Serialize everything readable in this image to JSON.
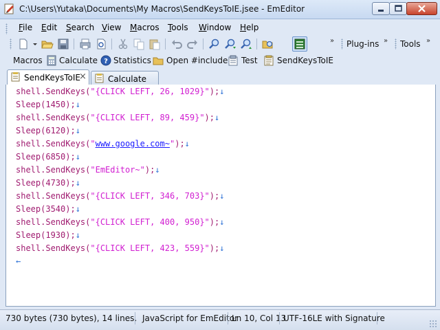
{
  "window": {
    "title": "C:\\Users\\Yutaka\\Documents\\My Macros\\SendKeysToIE.jsee - EmEditor"
  },
  "menubar": {
    "items": [
      {
        "u": "F",
        "rest": "ile"
      },
      {
        "u": "E",
        "rest": "dit"
      },
      {
        "u": "S",
        "rest": "earch"
      },
      {
        "u": "V",
        "rest": "iew"
      },
      {
        "u": "M",
        "rest": "acros"
      },
      {
        "u": "T",
        "rest": "ools"
      },
      {
        "u": "W",
        "rest": "indow"
      },
      {
        "u": "H",
        "rest": "elp"
      }
    ]
  },
  "toolbar": {
    "plugins_label": "Plug-ins",
    "tools_label": "Tools",
    "chevron": "»"
  },
  "macros_bar": {
    "label": "Macros",
    "items": [
      "Calculate",
      "Statistics",
      "Open #include",
      "Test",
      "SendKeysToIE"
    ]
  },
  "tabs": [
    {
      "label": "SendKeysToIE",
      "close": "×"
    },
    {
      "label": "Calculate"
    }
  ],
  "editor": {
    "lines": [
      [
        "shell.SendKeys(",
        "\"{CLICK LEFT, 26, 1029}\"",
        ");"
      ],
      [
        "Sleep(1450);"
      ],
      [
        "shell.SendKeys(",
        "\"{CLICK LEFT, 89, 459}\"",
        ");"
      ],
      [
        "Sleep(6120);"
      ],
      [
        "shell.SendKeys(",
        "\"",
        "www.google.com~",
        "\"",
        ");"
      ],
      [
        "Sleep(6850);"
      ],
      [
        "shell.SendKeys(",
        "\"EmEditor~\"",
        ");"
      ],
      [
        "Sleep(4730);"
      ],
      [
        "shell.SendKeys(",
        "\"{CLICK LEFT, 346, 703}\"",
        ");"
      ],
      [
        "Sleep(3540);"
      ],
      [
        "shell.SendKeys(",
        "\"{CLICK LEFT, 400, 950}\"",
        ");"
      ],
      [
        "Sleep(1930);"
      ],
      [
        "shell.SendKeys(",
        "\"{CLICK LEFT, 423, 559}\"",
        ");"
      ]
    ],
    "newline_mark": "↓",
    "eof_mark": "←"
  },
  "statusbar": {
    "size": "730 bytes (730 bytes), 14 lines.",
    "mode": "JavaScript for EmEditor",
    "position": "Ln 10, Col 13",
    "encoding": "UTF-16LE with Signature"
  },
  "colors": {
    "keyword": "#a01b70",
    "string": "#d11ed1",
    "link": "#1a1aff",
    "mark": "#2a6fd6"
  }
}
